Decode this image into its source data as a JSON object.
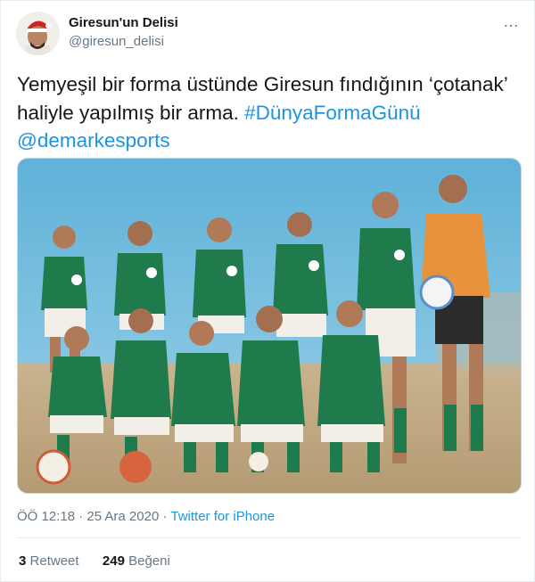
{
  "user": {
    "display_name": "Giresun'un Delisi",
    "handle": "@giresun_delisi"
  },
  "more_icon": "…",
  "tweet": {
    "text_part1": "Yemyeşil bir forma üstünde Giresun fındığının ‘çotanak’ haliyle yapılmış bir arma. ",
    "hashtag": "#DünyaFormaGünü",
    "mention": "@demarkesports"
  },
  "meta": {
    "time": "ÖÖ 12:18",
    "sep1": " · ",
    "date": "25 Ara 2020",
    "sep2": " · ",
    "source": "Twitter for iPhone"
  },
  "stats": {
    "retweet_count": "3",
    "retweet_label": "Retweet",
    "like_count": "249",
    "like_label": "Beğeni"
  },
  "colors": {
    "link": "#1b95e0",
    "kit_green": "#1f7a4c",
    "sky": "#6db6da"
  }
}
